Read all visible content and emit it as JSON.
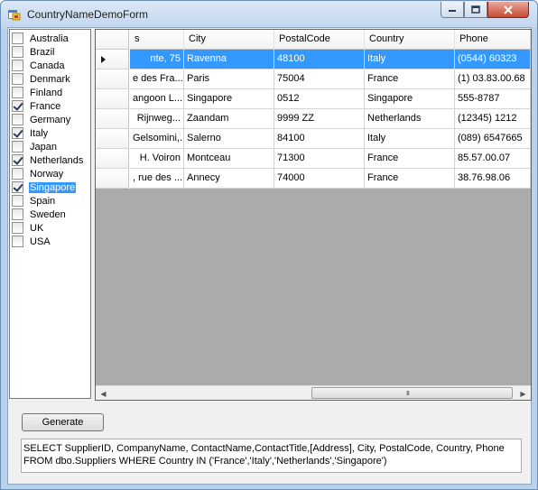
{
  "window": {
    "title": "CountryNameDemoForm"
  },
  "countries": [
    {
      "label": "Australia",
      "checked": false,
      "selected": false
    },
    {
      "label": "Brazil",
      "checked": false,
      "selected": false
    },
    {
      "label": "Canada",
      "checked": false,
      "selected": false
    },
    {
      "label": "Denmark",
      "checked": false,
      "selected": false
    },
    {
      "label": "Finland",
      "checked": false,
      "selected": false
    },
    {
      "label": "France",
      "checked": true,
      "selected": false
    },
    {
      "label": "Germany",
      "checked": false,
      "selected": false
    },
    {
      "label": "Italy",
      "checked": true,
      "selected": false
    },
    {
      "label": "Japan",
      "checked": false,
      "selected": false
    },
    {
      "label": "Netherlands",
      "checked": true,
      "selected": false
    },
    {
      "label": "Norway",
      "checked": false,
      "selected": false
    },
    {
      "label": "Singapore",
      "checked": true,
      "selected": true
    },
    {
      "label": "Spain",
      "checked": false,
      "selected": false
    },
    {
      "label": "Sweden",
      "checked": false,
      "selected": false
    },
    {
      "label": "UK",
      "checked": false,
      "selected": false
    },
    {
      "label": "USA",
      "checked": false,
      "selected": false
    }
  ],
  "grid": {
    "columns": [
      "s",
      "City",
      "PostalCode",
      "Country",
      "Phone"
    ],
    "rows": [
      [
        "nte, 75",
        "Ravenna",
        "48100",
        "Italy",
        "(0544) 60323"
      ],
      [
        "e des Fra...",
        "Paris",
        "75004",
        "France",
        "(1) 03.83.00.68"
      ],
      [
        "angoon L...",
        "Singapore",
        "0512",
        "Singapore",
        "555-8787"
      ],
      [
        "Rijnweg...",
        "Zaandam",
        "9999 ZZ",
        "Netherlands",
        "(12345) 1212"
      ],
      [
        "Gelsomini,...",
        "Salerno",
        "84100",
        "Italy",
        "(089) 6547665"
      ],
      [
        "H. Voiron",
        "Montceau",
        "71300",
        "France",
        "85.57.00.07"
      ],
      [
        ", rue des ...",
        "Annecy",
        "74000",
        "France",
        "38.76.98.06"
      ]
    ],
    "current_row": 0,
    "scroll_grip": "III"
  },
  "generate_button": {
    "label": "Generate"
  },
  "sql_output": {
    "text": "SELECT SupplierID, CompanyName, ContactName,ContactTitle,[Address], City, PostalCode, Country, Phone FROM dbo.Suppliers WHERE Country IN ('France','Italy','Netherlands','Singapore')"
  }
}
